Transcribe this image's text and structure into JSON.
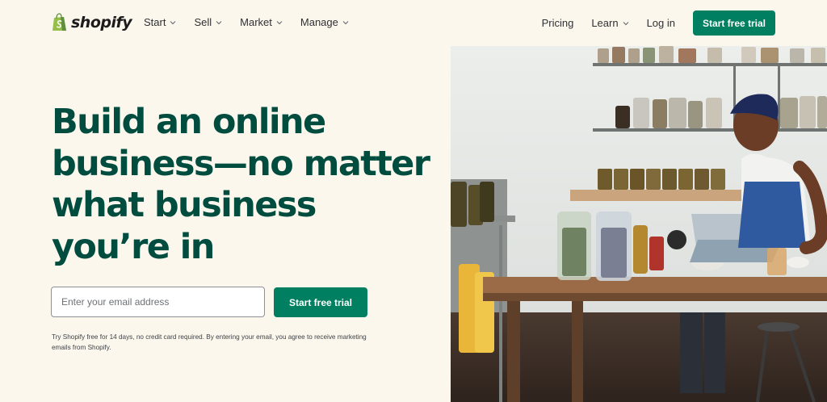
{
  "brand": {
    "name": "shopify",
    "logo_icon": "shopping-bag-icon",
    "primary_color": "#008060",
    "headline_color": "#004c3f",
    "background_color": "#fbf7ed"
  },
  "nav": {
    "left": [
      {
        "label": "Start"
      },
      {
        "label": "Sell"
      },
      {
        "label": "Market"
      },
      {
        "label": "Manage"
      }
    ],
    "pricing": "Pricing",
    "learn": "Learn",
    "login": "Log in",
    "cta": "Start free trial"
  },
  "hero": {
    "headline": "Build an online business—no matter what business you’re in",
    "email_placeholder": "Enter your email address",
    "cta": "Start free trial",
    "disclaimer": "Try Shopify free for 14 days, no credit card required. By entering your email, you agree to receive marketing emails from Shopify."
  }
}
